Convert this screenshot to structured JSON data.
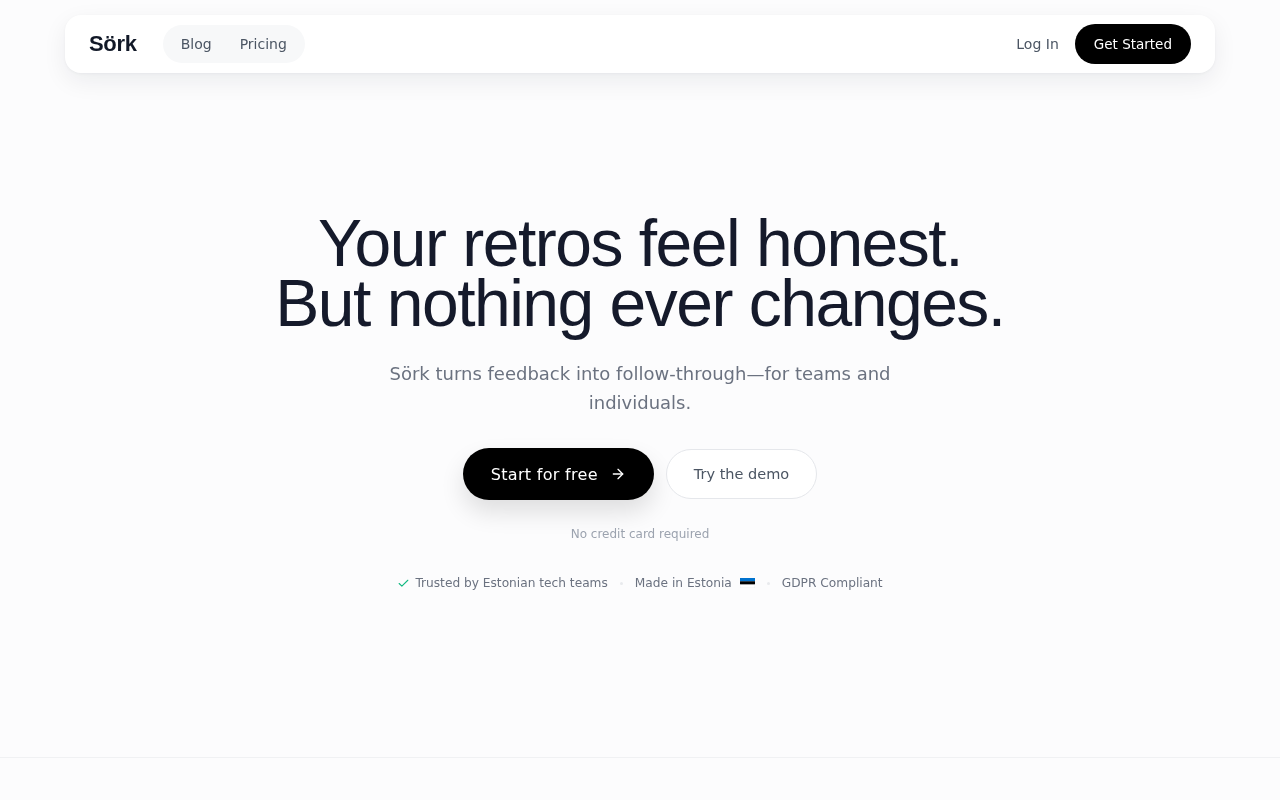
{
  "header": {
    "logo": "Sörk",
    "nav": [
      "Blog",
      "Pricing"
    ],
    "login": "Log In",
    "cta": "Get Started"
  },
  "hero": {
    "headline": [
      "Your retros feel honest.",
      "But nothing ever changes."
    ],
    "subtitle": "Sörk turns feedback into follow-through—for teams and individuals.",
    "primary_button": "Start for free",
    "secondary_button": "Try the demo",
    "note": "No credit card required",
    "trust_badges": [
      {
        "kind": "check",
        "text": "Trusted by Estonian tech teams"
      },
      {
        "kind": "flag",
        "text": "Made in Estonia"
      },
      {
        "kind": "plain",
        "text": "GDPR Compliant"
      }
    ]
  }
}
